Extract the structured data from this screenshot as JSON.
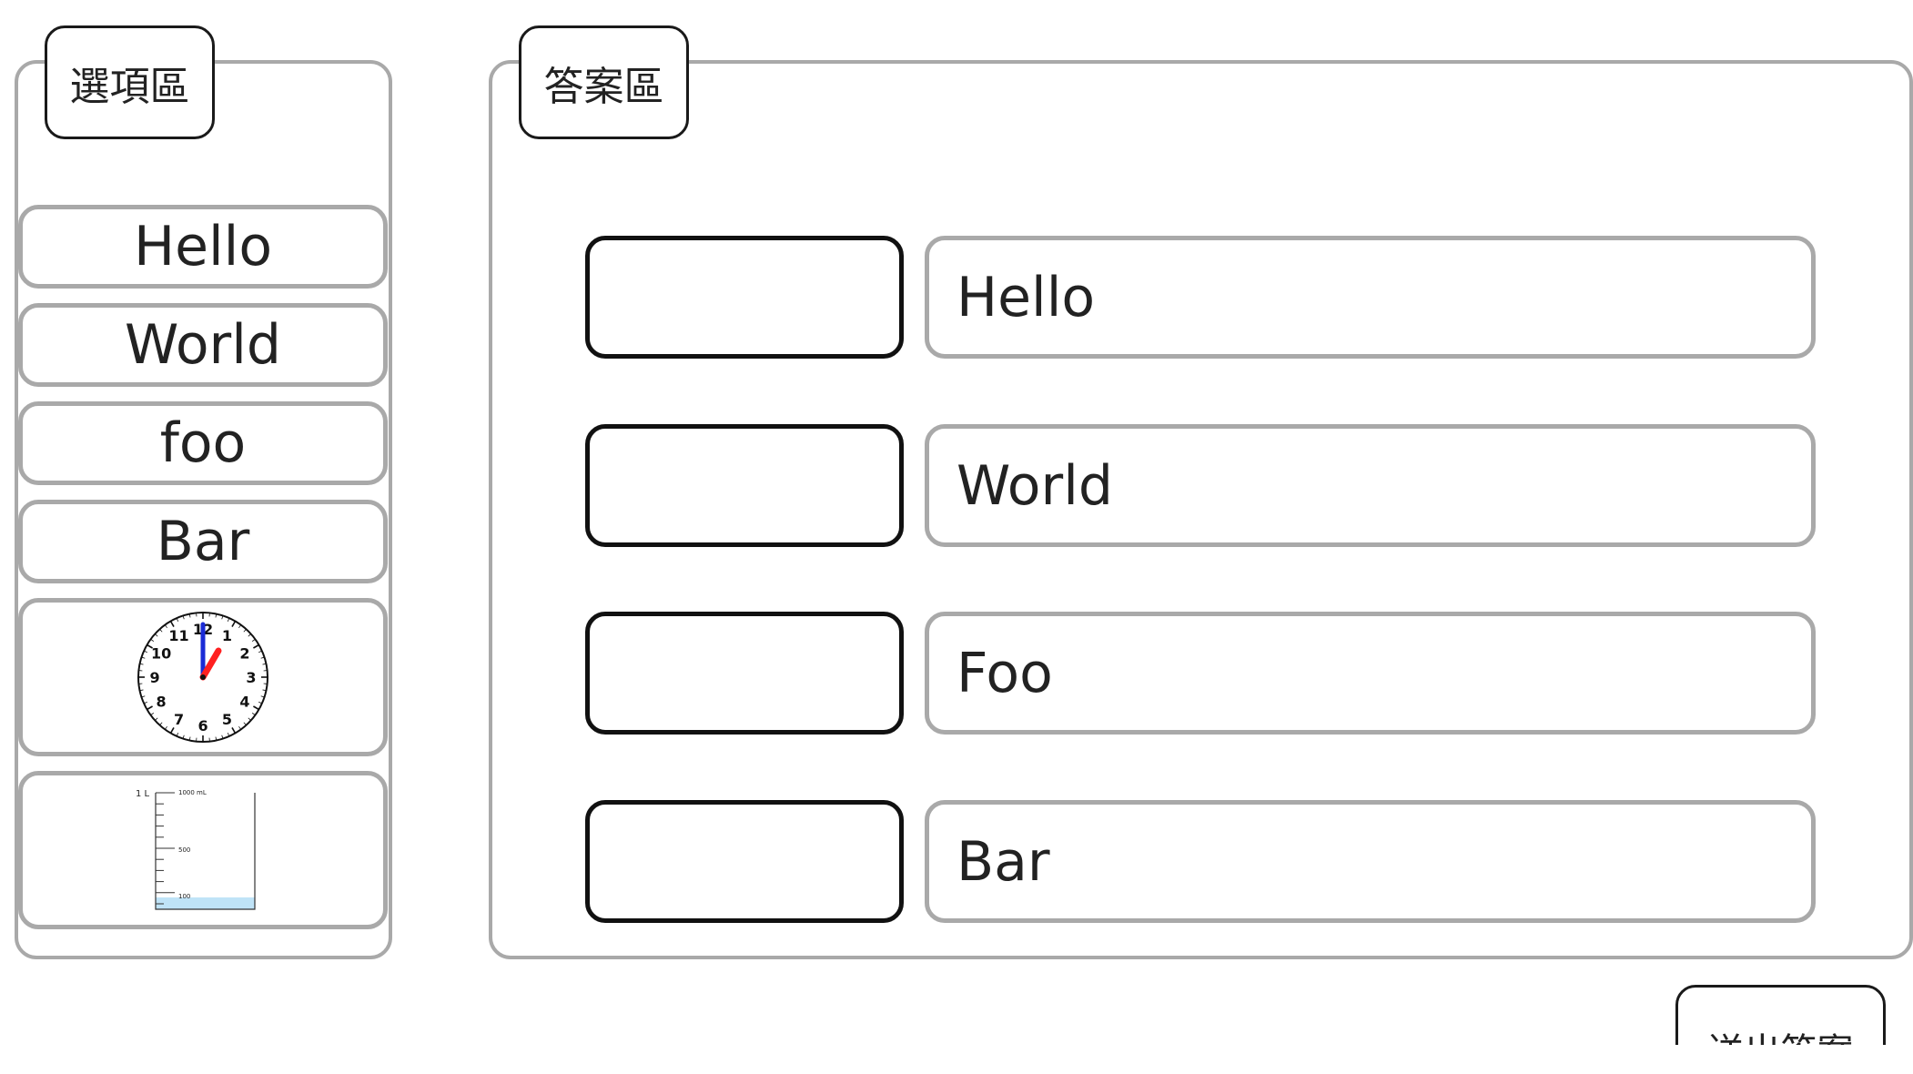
{
  "options_panel": {
    "title": "選項區",
    "items": [
      {
        "label": "Hello"
      },
      {
        "label": "World"
      },
      {
        "label": "foo"
      },
      {
        "label": "Bar"
      },
      {
        "icon": "analog-clock-icon"
      },
      {
        "icon": "measuring-beaker-icon"
      }
    ],
    "clock_numbers": [
      "12",
      "1",
      "2",
      "3",
      "4",
      "5",
      "6",
      "7",
      "8",
      "9",
      "10",
      "11"
    ],
    "beaker": {
      "capacity_label": "1 L",
      "top_mark": "1000 mL",
      "mid_mark": "500",
      "low_mark": "100"
    }
  },
  "answer_panel": {
    "title": "答案區",
    "rows": [
      {
        "prompt": "Hello"
      },
      {
        "prompt": "World"
      },
      {
        "prompt": "Foo"
      },
      {
        "prompt": "Bar"
      }
    ]
  },
  "submit_label": "送出答案",
  "colors": {
    "panel_border": "#a9a9a9",
    "slot_border": "#111111",
    "clock_hour_hand": "#ff2020",
    "clock_minute_hand": "#1a2bd6",
    "beaker_liquid": "#bfe3f7"
  }
}
